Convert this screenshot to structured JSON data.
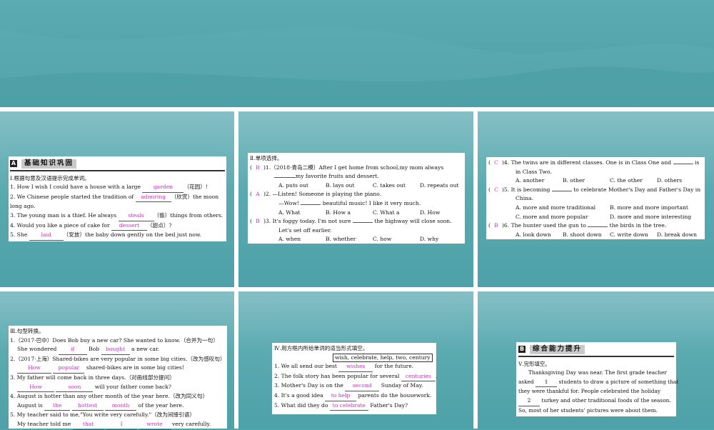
{
  "colors": {
    "answer": "#c92fc0",
    "background": "#4fa6ac"
  },
  "p1": {
    "letter": "A",
    "header": "基础知识巩固",
    "section": "Ⅰ.根据句意及汉语提示完成单词。",
    "l1a": "1. How I wish I could have a house with a large",
    "l1ans": "garden",
    "l1b": "（花园）!",
    "l2a": "2. We Chinese people started the tradition of",
    "l2ans": "admiring",
    "l2b": "（欣赏）the moon",
    "l2c": "long ago.",
    "l3a": "3. The young man is a thief. He always",
    "l3ans": "steals",
    "l3b": "（偷）things from others.",
    "l4a": "4. Would you like a piece of cake for",
    "l4ans": "dessert",
    "l4b": "（甜点）?",
    "l5a": "5. She",
    "l5ans": "laid",
    "l5b": "（安放）the baby down gently on the bed just now."
  },
  "p2": {
    "section": "Ⅱ.单项选择。",
    "q1pre": "(",
    "q1ans": "B",
    "q1post": ")1.（2018·青岛二模）After I get home from school,my mom always",
    "q1b": "my favorite fruits and dessert.",
    "q1o": [
      "A. puts out",
      "B. lays out",
      "C. takes out",
      "D. repeats out"
    ],
    "q2pre": "(",
    "q2ans": "A",
    "q2post": ")2. —Listen! Someone is playing the piano.",
    "q2b": "—Wow!",
    "q2c": "beautiful music! I like it very much.",
    "q2o": [
      "A. What",
      "B. How a",
      "C. What a",
      "D. How"
    ],
    "q3pre": "(",
    "q3ans": "B",
    "q3post": ")3. It's foggy today. I'm not sure",
    "q3c": "the highway will close soon.",
    "q3b": "Let's set off earlier.",
    "q3o": [
      "A. when",
      "B. whether",
      "C. how",
      "D. why"
    ]
  },
  "p3": {
    "q4pre": "(",
    "q4ans": "C",
    "q4post": ")4. The twins are in different classes. One is in Class One and",
    "q4c": "is",
    "q4b": "in Class Two.",
    "q4o": [
      "A. another",
      "B. other",
      "C. the other",
      "D. others"
    ],
    "q5pre": "(",
    "q5ans": "C",
    "q5post": ")5. It is becoming",
    "q5c": "to celebrate Mother's Day and Father's Day in",
    "q5b": "China.",
    "q5o": [
      "A. more and more traditional",
      "B. more and more important",
      "C. more and more popular",
      "D. more and more interesting"
    ],
    "q6pre": "(",
    "q6ans": "B",
    "q6post": ")6. The hunter used the gun to",
    "q6c": "the birds in the tree.",
    "q6o": [
      "A. look down",
      "B. shoot down",
      "C. write down",
      "D. break down"
    ]
  },
  "p4": {
    "section": "Ⅲ.句型转换。",
    "l1": "1.（2017·巴中）Does Bob buy a new car? She wanted to know.（合并为一句）",
    "l1a": "She wondered",
    "l1ans1": "if",
    "l1m": "Bob",
    "l1ans2": "bought",
    "l1b": "a new car.",
    "l2": "2.（2017·上海）Shared-bikes are very popular in some big cities.（改为感叹句）",
    "l2ans1": "How",
    "l2ans2": "popular",
    "l2b": "shared-bikes are in some big cities!",
    "l3": "3. My father will come back in three days.（对画线部分提问）",
    "l3ans1": "How",
    "l3ans2": "soon",
    "l3b": "will your father come back?",
    "l4": "4. August is hotter than any other month of the year here.（改为同义句）",
    "l4a": "August is",
    "l4ans1": "the",
    "l4ans2": "hottest",
    "l4ans3": "month",
    "l4b": "of the year here.",
    "l5": "5. My teacher said to me,\"You write very carefully.\"（改为间接引语）",
    "l5a": "My teacher told me",
    "l5ans1": "that",
    "l5ans2": "I",
    "l5ans3": "wrote",
    "l5b": "very carefully."
  },
  "p5": {
    "section": "Ⅳ.用方框内所给单词的适当形式填空。",
    "words": "wish, celebrate, help, two, century",
    "l1a": "1. We all send our best",
    "l1ans": "wishes",
    "l1b": "for the future.",
    "l2a": "2. The folk story has been popular for several",
    "l2ans": "centuries",
    "l2b": ".",
    "l3a": "3. Mother's Day is on the",
    "l3ans": "second",
    "l3b": "Sunday of May.",
    "l4a": "4. It's a good idea",
    "l4ans": "to help",
    "l4b": "parents do the housework.",
    "l5a": "5. What did they do",
    "l5ans": "to celebrate",
    "l5b": "Father's Day?"
  },
  "p6": {
    "letter": "B",
    "header": "综合能力提升",
    "section": "Ⅴ.完形填空。",
    "t1": "Thanksgiving Day was near. The first grade teacher",
    "t2a": "asked",
    "t2ans": "1",
    "t2b": "students to draw a picture of something that",
    "t3": "they were thankful for. People celebrated the holiday",
    "t4ans": "2",
    "t4b": "turkey and other traditional foods of the season.",
    "t5": "So, most of her students' pictures were about them."
  }
}
